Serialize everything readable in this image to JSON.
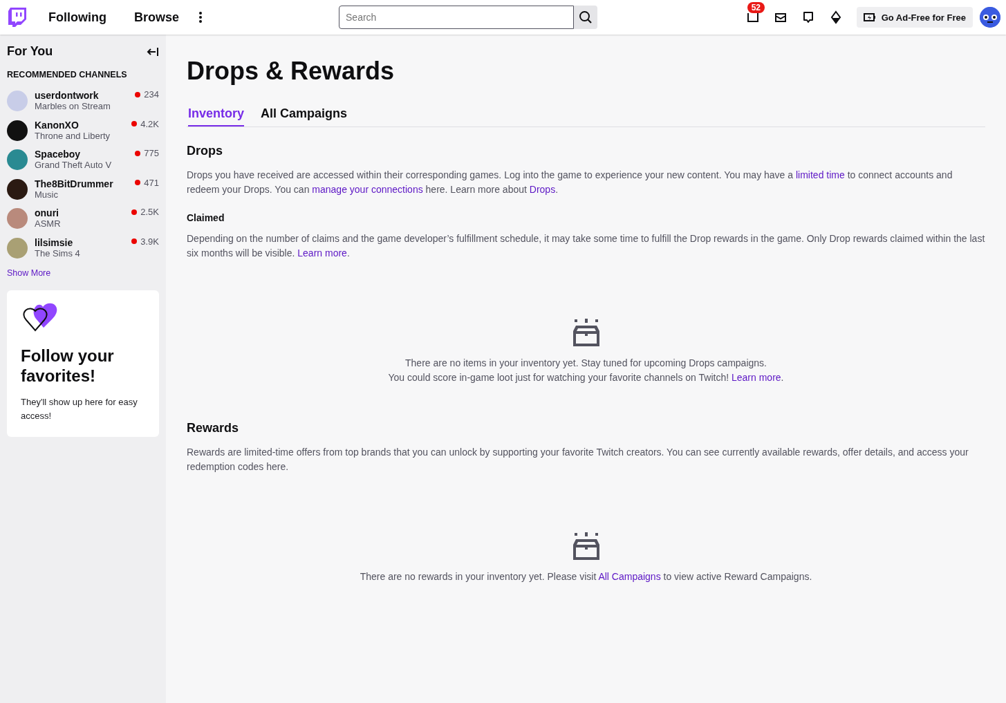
{
  "topbar": {
    "nav": [
      "Following",
      "Browse"
    ],
    "search": {
      "placeholder": "Search"
    },
    "notifications_badge": "52",
    "ad_free_button": "Go Ad-Free for Free"
  },
  "sidebar": {
    "title": "For You",
    "section_title": "RECOMMENDED CHANNELS",
    "channels": [
      {
        "name": "userdontwork",
        "category": "Marbles on Stream",
        "viewers": "234",
        "color": "#c8cde8"
      },
      {
        "name": "KanonXO",
        "category": "Throne and Liberty",
        "viewers": "4.2K",
        "color": "#111111"
      },
      {
        "name": "Spaceboy",
        "category": "Grand Theft Auto V",
        "viewers": "775",
        "color": "#2a8a92"
      },
      {
        "name": "The8BitDrummer",
        "category": "Music",
        "viewers": "471",
        "color": "#2b1a12"
      },
      {
        "name": "onuri",
        "category": "ASMR",
        "viewers": "2.5K",
        "color": "#b98a7c"
      },
      {
        "name": "lilsimsie",
        "category": "The Sims 4",
        "viewers": "3.9K",
        "color": "#a9a074"
      }
    ],
    "show_more": "Show More",
    "promo": {
      "title": "Follow your favorites!",
      "text": "They'll show up here for easy access!"
    }
  },
  "main": {
    "title": "Drops & Rewards",
    "tabs": [
      {
        "label": "Inventory",
        "selected": true
      },
      {
        "label": "All Campaigns",
        "selected": false
      }
    ],
    "sections": [
      {
        "heading": "Drops",
        "kind": "h2",
        "paragraph": [
          {
            "text": "Drops you have received are accessed within their corresponding games. Log into the game to experience your new content. You may have a "
          },
          {
            "link": "limited time"
          },
          {
            "text": " to connect accounts and redeem your Drops. You can "
          },
          {
            "link": "manage your connections"
          },
          {
            "text": " here. Learn more about "
          },
          {
            "link": "Drops"
          },
          {
            "text": "."
          }
        ]
      },
      {
        "heading": "Claimed",
        "kind": "h3",
        "paragraph": [
          {
            "text": "Depending on the number of claims and the game developer’s fulfillment schedule, it may take some time to fulfill the Drop rewards in the game. Only Drop rewards claimed within the last six months will be visible. "
          },
          {
            "link": "Learn more"
          },
          {
            "text": "."
          }
        ],
        "empty": [
          [
            {
              "text": "There are no items in your inventory yet. Stay tuned for upcoming Drops campaigns."
            }
          ],
          [
            {
              "text": "You could score in-game loot just for watching your favorite channels on Twitch! "
            },
            {
              "link": "Learn more"
            },
            {
              "text": "."
            }
          ]
        ]
      },
      {
        "heading": "Rewards",
        "kind": "h2",
        "paragraph": [
          {
            "text": "Rewards are limited-time offers from top brands that you can unlock by supporting your favorite Twitch creators. You can see currently available rewards, offer details, and access your redemption codes here."
          }
        ],
        "empty": [
          [
            {
              "text": "There are no rewards in your inventory yet. Please visit "
            },
            {
              "link": "All Campaigns"
            },
            {
              "text": " to view active Reward Campaigns."
            }
          ]
        ]
      }
    ]
  }
}
